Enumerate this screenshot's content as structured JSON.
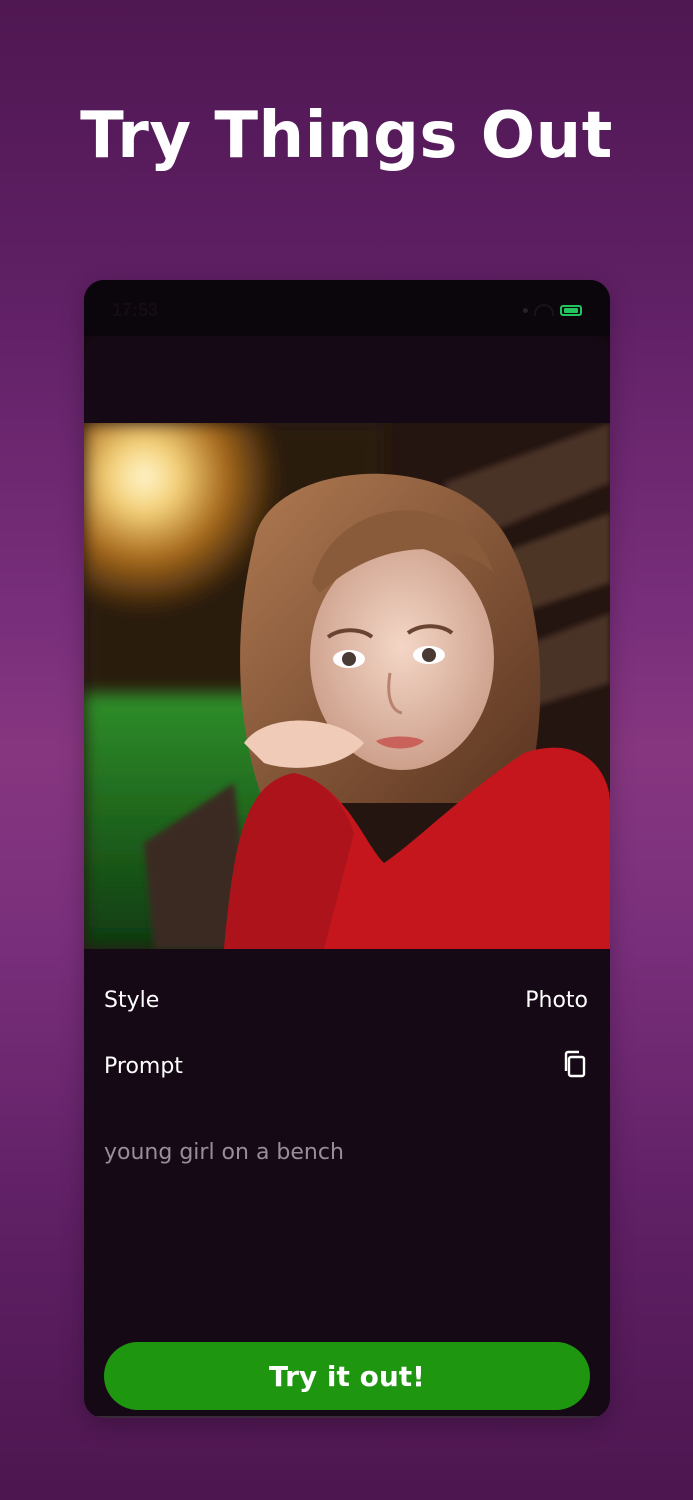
{
  "headline": "Try Things Out",
  "status_bar": {
    "time": "17:53",
    "battery_color": "#22c55e"
  },
  "image": {
    "alt": "young girl on a bench"
  },
  "style_row": {
    "label": "Style",
    "value": "Photo"
  },
  "prompt_row": {
    "label": "Prompt",
    "copy_icon": "copy-icon",
    "text": "young girl on a bench"
  },
  "cta": {
    "label": "Try it out!",
    "color": "#1f9610"
  },
  "colors": {
    "background": "#6e2a70",
    "panel": "#150915",
    "text": "#ffffff",
    "muted_text": "#9a8d98"
  }
}
